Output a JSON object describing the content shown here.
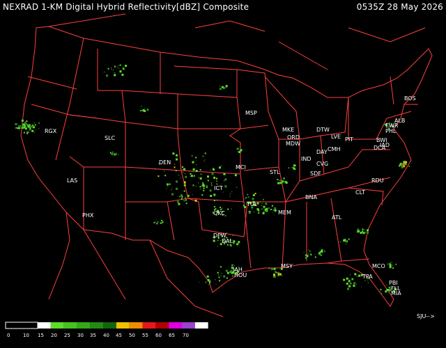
{
  "header": {
    "title": "NEXRAD 1-KM Digital Hybrid Reflectivity[dBZ] Composite",
    "timestamp": "0535Z 28 May 2026"
  },
  "arrow_label": "SJU-->",
  "cities": [
    {
      "code": "MSP"
    },
    {
      "code": "BOS"
    },
    {
      "code": "RGX"
    },
    {
      "code": "SLC"
    },
    {
      "code": "MKE"
    },
    {
      "code": "DTW"
    },
    {
      "code": "ORD"
    },
    {
      "code": "MDW"
    },
    {
      "code": "LVE"
    },
    {
      "code": "ALB"
    },
    {
      "code": "EWR"
    },
    {
      "code": "PHL"
    },
    {
      "code": "PIT"
    },
    {
      "code": "CMH"
    },
    {
      "code": "DAY"
    },
    {
      "code": "IND"
    },
    {
      "code": "CVG"
    },
    {
      "code": "SDF"
    },
    {
      "code": "BWI"
    },
    {
      "code": "DCA"
    },
    {
      "code": "IAD"
    },
    {
      "code": "DEN"
    },
    {
      "code": "MCI"
    },
    {
      "code": "STL"
    },
    {
      "code": "LAS"
    },
    {
      "code": "ICT"
    },
    {
      "code": "RDU"
    },
    {
      "code": "CLT"
    },
    {
      "code": "BNA"
    },
    {
      "code": "TUL"
    },
    {
      "code": "OKC"
    },
    {
      "code": "MEM"
    },
    {
      "code": "PHX"
    },
    {
      "code": "ATL"
    },
    {
      "code": "DFW"
    },
    {
      "code": "DAL"
    },
    {
      "code": "IAH"
    },
    {
      "code": "HOU"
    },
    {
      "code": "MSY"
    },
    {
      "code": "MCO"
    },
    {
      "code": "TPA"
    },
    {
      "code": "PBI"
    },
    {
      "code": "FLL"
    },
    {
      "code": "MIA"
    }
  ],
  "legend": {
    "ticks": [
      "0",
      "10",
      "15",
      "20",
      "25",
      "30",
      "35",
      "40",
      "45",
      "50",
      "55",
      "60",
      "65",
      "70"
    ],
    "colors": [
      "#000000",
      "#ffffff",
      "#5cdc2c",
      "#46c31e",
      "#34a81a",
      "#248a14",
      "#12660c",
      "#f0c000",
      "#f08c00",
      "#e81818",
      "#b00000",
      "#e000e0",
      "#9c40d0",
      "#ffffff"
    ]
  },
  "colors": {
    "background": "#000000",
    "borders": "#ff4040",
    "text": "#ffffff",
    "echo_light": "#5cdc2c",
    "echo_mid": "#2d8a1e",
    "echo_high": "#f0c000",
    "echo_core": "#e81818"
  }
}
